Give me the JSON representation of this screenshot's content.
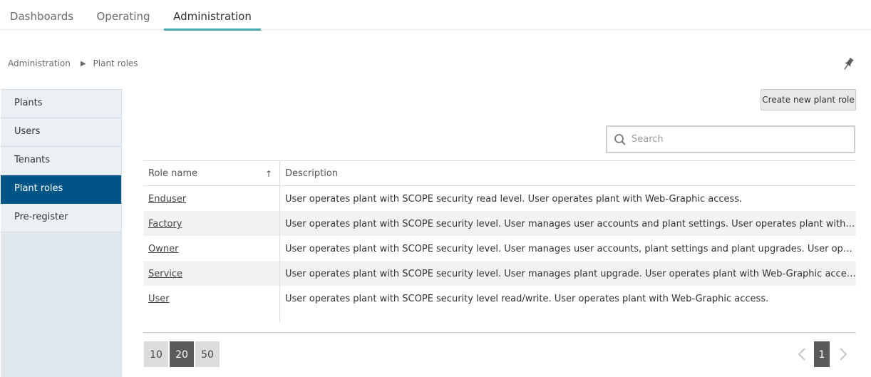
{
  "nav": {
    "tabs": [
      {
        "label": "Dashboards",
        "active": false
      },
      {
        "label": "Operating",
        "active": false
      },
      {
        "label": "Administration",
        "active": true
      }
    ]
  },
  "breadcrumb": {
    "items": [
      "Administration",
      "Plant roles"
    ]
  },
  "sidebar": {
    "items": [
      {
        "label": "Plants",
        "active": false
      },
      {
        "label": "Users",
        "active": false
      },
      {
        "label": "Tenants",
        "active": false
      },
      {
        "label": "Plant roles",
        "active": true
      },
      {
        "label": "Pre-register",
        "active": false
      }
    ]
  },
  "toolbar": {
    "create_label": "Create new plant role"
  },
  "search": {
    "placeholder": "Search",
    "value": ""
  },
  "table": {
    "columns": [
      "Role name",
      "Description"
    ],
    "sort_indicator": "↑",
    "rows": [
      {
        "name": "Enduser",
        "description": "User operates plant with SCOPE security read level. User operates plant with Web-Graphic access."
      },
      {
        "name": "Factory",
        "description": "User operates plant with SCOPE security level.  User manages user accounts and plant settings. User operates plant with Web-G..."
      },
      {
        "name": "Owner",
        "description": "User operates plant with SCOPE security level.  User manages user accounts, plant settings and plant upgrades. User operates pl..."
      },
      {
        "name": "Service",
        "description": "User operates plant with SCOPE security level. User manages plant upgrade. User operates plant with Web-Graphic access."
      },
      {
        "name": "User",
        "description": "User operates plant with SCOPE security level read/write. User operates plant with Web-Graphic access."
      }
    ]
  },
  "pagination": {
    "page_sizes": [
      "10",
      "20",
      "50"
    ],
    "selected_page_size": "20",
    "current_page": "1"
  },
  "colors": {
    "accent": "#41aaaa",
    "sidebar_active": "#005587"
  }
}
